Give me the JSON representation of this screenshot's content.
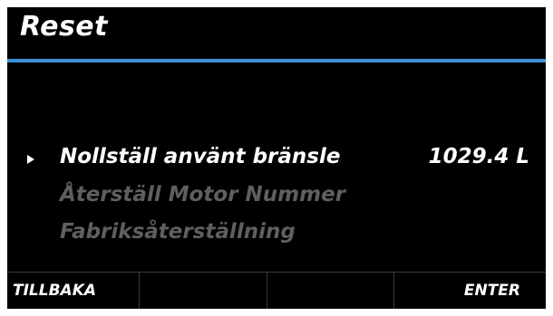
{
  "header": {
    "title": "Reset"
  },
  "colors": {
    "accent": "#3f8fd0",
    "dim_text": "#5f5f5f"
  },
  "menu": {
    "items": [
      {
        "label": "Nollställ använt bränsle",
        "value": "1029.4 L",
        "selected": true
      },
      {
        "label": "Återställ Motor Nummer",
        "selected": false
      },
      {
        "label": "Fabriksåterställning",
        "selected": false
      }
    ]
  },
  "softkeys": {
    "key1": "TILLBAKA",
    "key2": "",
    "key3": "",
    "key4": "ENTER"
  }
}
